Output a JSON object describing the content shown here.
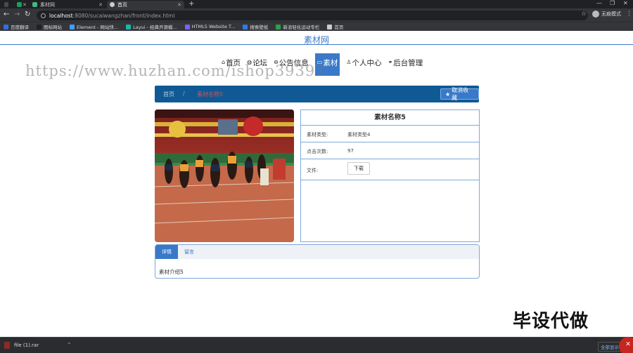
{
  "browser": {
    "tabs": [
      {
        "label": "",
        "fav_color": "#4a4a4a"
      },
      {
        "label": "",
        "fav_color": "#18a058"
      },
      {
        "label": "素材网",
        "fav_color": "#41b883"
      },
      {
        "label": "首页",
        "fav_color": "#cccccc"
      }
    ],
    "new_tab": "+",
    "url_host": "localhost",
    "url_path": ":8080/sucaiwangzhan/front/index.html",
    "profile_label": "无痕模式",
    "bookmarks": [
      {
        "label": "百度翻译",
        "color": "#2f6fe0"
      },
      {
        "label": "图标网站",
        "color": "#222222"
      },
      {
        "label": "Element - 网站快...",
        "color": "#409eff"
      },
      {
        "label": "Layui - 经典开源模...",
        "color": "#16baaa"
      },
      {
        "label": "HTML5 Website T...",
        "color": "#7b61ff"
      },
      {
        "label": "搜索壁纸",
        "color": "#2d7be5"
      },
      {
        "label": "新浪轻化运动专栏",
        "color": "#2ba245"
      },
      {
        "label": "首页",
        "color": "#cccccc"
      }
    ]
  },
  "site": {
    "title": "素材网",
    "nav": [
      {
        "label": "首页",
        "icon": "⌂"
      },
      {
        "label": "论坛",
        "icon": "◍"
      },
      {
        "label": "公告信息",
        "icon": "⊖"
      },
      {
        "label": "素材",
        "icon": "▭"
      },
      {
        "label": "个人中心",
        "icon": "♙"
      },
      {
        "label": "后台管理",
        "icon": "⚭"
      }
    ],
    "watermark": "https://www.huzhan.com/ishop39397"
  },
  "breadcrumb": {
    "home": "首页",
    "sep": "/",
    "current": "素材名称5"
  },
  "favorite_button": "取消收藏",
  "material": {
    "name": "素材名称5",
    "fields": [
      {
        "key": "素材类型:",
        "value": "素材类型4"
      },
      {
        "key": "点击次数:",
        "value": "97"
      }
    ],
    "file_label": "文件:",
    "download_label": "下载"
  },
  "detail_tabs": [
    "详情",
    "留言"
  ],
  "detail_body": "素材介绍5",
  "promo_text": "毕设代做",
  "downloads": {
    "file": "file (1).rar",
    "show_all": "全部显示"
  },
  "colors": {
    "primary": "#3a79c9",
    "breadcrumb_bar": "#0f5a95"
  }
}
